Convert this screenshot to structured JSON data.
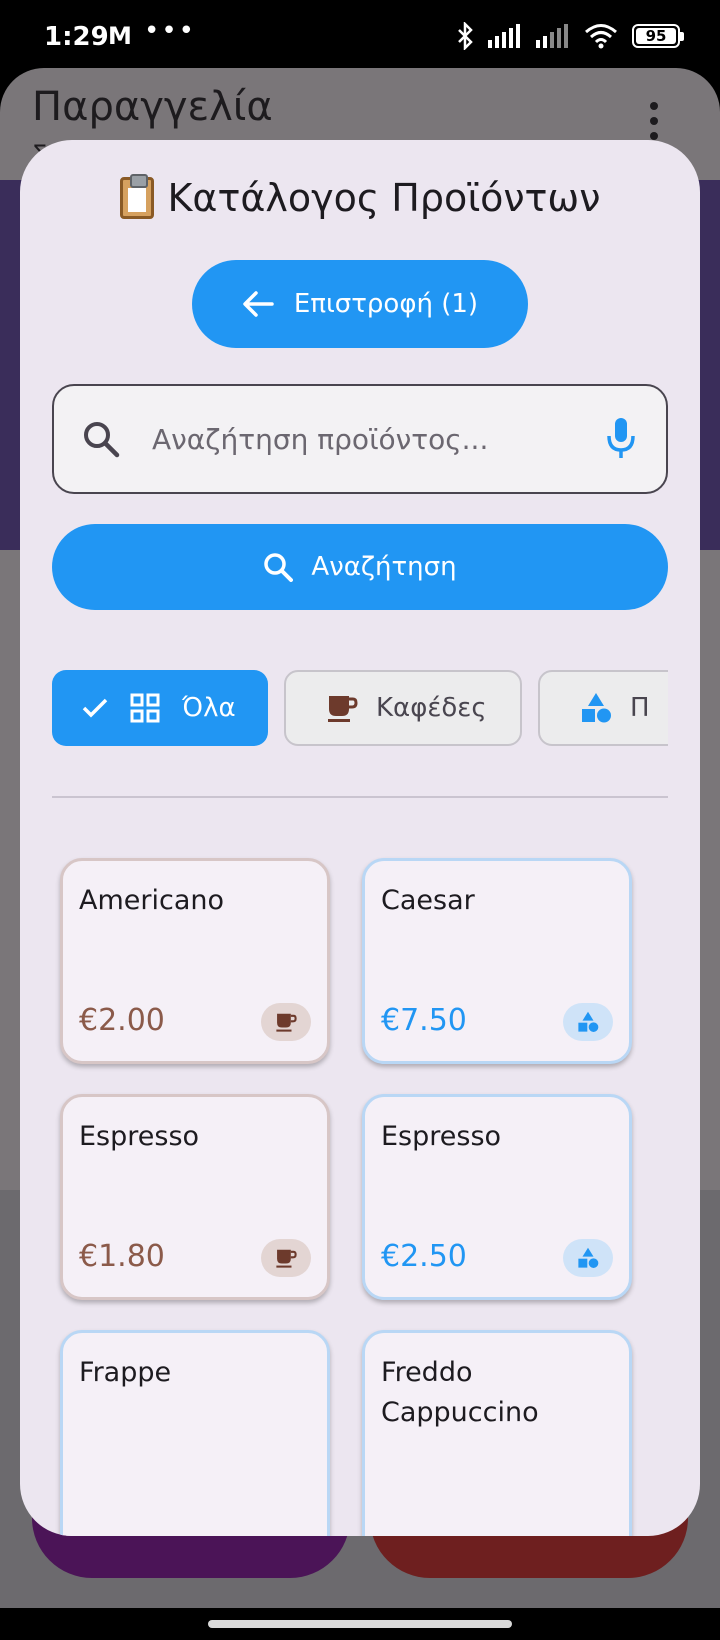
{
  "status_bar": {
    "time": "1:29",
    "mail_icon": "M",
    "more": "•••",
    "battery": "95"
  },
  "background_app": {
    "title": "Παραγγελία",
    "subtitle": "Σ"
  },
  "dialog": {
    "title": "Κατάλογος Προϊόντων",
    "back_button_label": "Επιστροφή (1)",
    "search": {
      "placeholder": "Αναζήτηση προϊόντος...",
      "value": ""
    },
    "search_button_label": "Αναζήτηση",
    "filters": [
      {
        "label": "Όλα",
        "selected": true,
        "icon": "grid-icon"
      },
      {
        "label": "Καφέδες",
        "selected": false,
        "icon": "coffee-cup-icon"
      },
      {
        "label": "Π",
        "selected": false,
        "icon": "category-shapes-icon"
      }
    ],
    "products": [
      {
        "name": "Americano",
        "price": "€2.00",
        "category": "coffee"
      },
      {
        "name": "Caesar",
        "price": "€7.50",
        "category": "food"
      },
      {
        "name": "Espresso",
        "price": "€1.80",
        "category": "coffee"
      },
      {
        "name": "Espresso",
        "price": "€2.50",
        "category": "food"
      },
      {
        "name": "Frappe",
        "price": "",
        "category": "food"
      },
      {
        "name": "Freddo Cappuccino",
        "price": "",
        "category": "food"
      }
    ]
  },
  "colors": {
    "accent": "#2196f3",
    "coffee": "#8b5a4a",
    "dialog_bg": "#ece6f0"
  }
}
